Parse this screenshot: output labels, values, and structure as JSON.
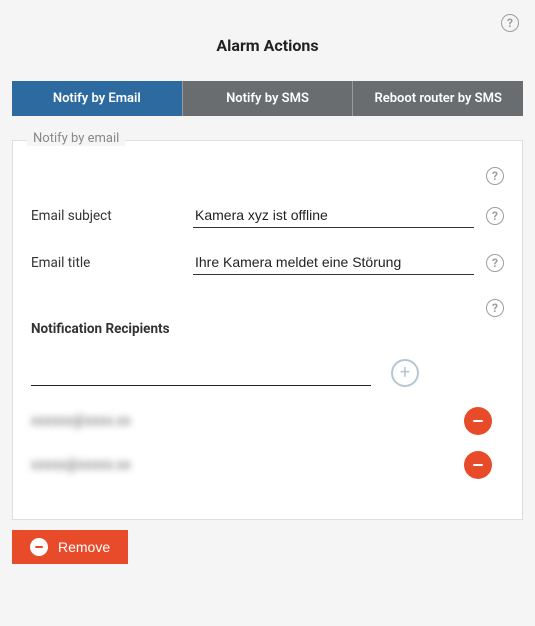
{
  "header": {
    "title": "Alarm Actions"
  },
  "tabs": [
    {
      "label": "Notify by Email",
      "active": true
    },
    {
      "label": "Notify by SMS",
      "active": false
    },
    {
      "label": "Reboot router by SMS",
      "active": false
    }
  ],
  "panel": {
    "legend": "Notify by email",
    "fields": {
      "subject_label": "Email subject",
      "subject_value": "Kamera xyz ist offline",
      "title_label": "Email title",
      "title_value": "Ihre Kamera meldet eine Störung"
    },
    "recipients": {
      "heading": "Notification Recipients",
      "input_value": "",
      "list": [
        {
          "display": "xxxxxx@xxxx.xx"
        },
        {
          "display": "xxxxx@xxxxx.xx"
        }
      ]
    }
  },
  "footer": {
    "remove_label": "Remove"
  }
}
